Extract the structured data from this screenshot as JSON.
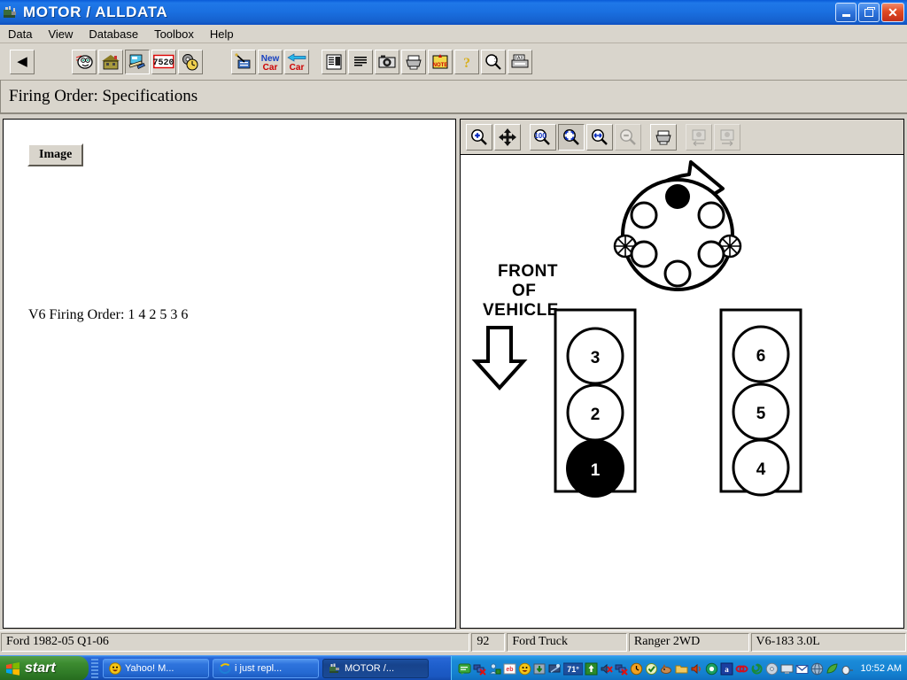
{
  "window": {
    "title": "MOTOR / ALLDATA",
    "icon": "engine-icon",
    "minimize_label": "Minimize",
    "maximize_label": "Restore",
    "close_label": "Close"
  },
  "menubar": {
    "items": [
      {
        "label": "Data",
        "name": "menu-data"
      },
      {
        "label": "View",
        "name": "menu-view"
      },
      {
        "label": "Database",
        "name": "menu-database"
      },
      {
        "label": "Toolbox",
        "name": "menu-toolbox"
      },
      {
        "label": "Help",
        "name": "menu-help"
      }
    ]
  },
  "toolbar": {
    "buttons": [
      {
        "name": "back-button",
        "icon": "left-arrow-icon",
        "glyph": "◀",
        "state": "raised",
        "color": "#000000"
      },
      {
        "name": "mascot-button",
        "icon": "face-icon",
        "glyph": "☺",
        "state": "raised",
        "color": "#1b1b1b"
      },
      {
        "name": "home-button",
        "icon": "house-icon",
        "glyph": "⌂",
        "state": "raised",
        "color": "#6b6320"
      },
      {
        "name": "repair-button",
        "icon": "tools-icon",
        "glyph": "⚒",
        "state": "sunken",
        "color": "#1c5aa8"
      },
      {
        "name": "estimator-button",
        "icon": "calculator-icon",
        "glyph": "7520",
        "state": "raised",
        "color": "#cc0000"
      },
      {
        "name": "labor-time-button",
        "icon": "gear-clock-icon",
        "glyph": "⚙",
        "state": "raised",
        "color": "#b08a20"
      },
      {
        "name": "worksheet-button",
        "icon": "clipboard-pen-icon",
        "glyph": "✎",
        "state": "raised",
        "color": "#1c5aa8"
      },
      {
        "name": "new-car-button",
        "icon": "new-car-icon",
        "glyph": "New Car",
        "state": "raised",
        "color": "#cc0000"
      },
      {
        "name": "prev-car-button",
        "icon": "back-car-icon",
        "glyph": "Car",
        "state": "raised",
        "color": "#cc0000"
      },
      {
        "name": "index-button",
        "icon": "list-index-icon",
        "glyph": "≡",
        "state": "raised",
        "color": "#111111"
      },
      {
        "name": "text-button",
        "icon": "paragraph-icon",
        "glyph": "☰",
        "state": "raised",
        "color": "#111111"
      },
      {
        "name": "image-button",
        "icon": "camera-icon",
        "glyph": "▣",
        "state": "raised",
        "color": "#111111"
      },
      {
        "name": "print-button",
        "icon": "printer-icon",
        "glyph": "⎙",
        "state": "raised",
        "color": "#333333"
      },
      {
        "name": "note-button",
        "icon": "note-pin-icon",
        "glyph": "NOTE",
        "state": "raised",
        "color": "#cc0000"
      },
      {
        "name": "help-button",
        "icon": "question-mark-icon",
        "glyph": "?",
        "state": "raised",
        "color": "#c8a000"
      },
      {
        "name": "find-button",
        "icon": "magnifier-az-icon",
        "glyph": "ὐD",
        "state": "raised",
        "color": "#111111"
      },
      {
        "name": "fax-button",
        "icon": "fax-icon",
        "glyph": "FAX",
        "state": "raised",
        "color": "#333333"
      }
    ]
  },
  "section": {
    "title": "Firing Order:  Specifications"
  },
  "left_panel": {
    "image_button_label": "Image",
    "body_text": "V6 Firing Order: 1 4 2 5 3 6"
  },
  "viewer_toolbar": {
    "buttons": [
      {
        "name": "zoom-in-button",
        "icon": "magnifier-plus-icon",
        "state": "raised"
      },
      {
        "name": "pan-button",
        "icon": "four-way-move-icon",
        "state": "raised"
      },
      {
        "name": "zoom-100-button",
        "icon": "magnifier-100-percent-icon",
        "state": "raised"
      },
      {
        "name": "fit-page-button",
        "icon": "magnifier-fit-page-icon",
        "state": "pressed"
      },
      {
        "name": "fit-width-button",
        "icon": "magnifier-fit-width-icon",
        "state": "raised"
      },
      {
        "name": "zoom-out-button",
        "icon": "magnifier-minus-icon",
        "state": "disabled"
      },
      {
        "name": "print-image-button",
        "icon": "printer-icon",
        "state": "raised"
      },
      {
        "name": "previous-image-button",
        "icon": "previous-image-icon",
        "state": "disabled"
      },
      {
        "name": "next-image-button",
        "icon": "next-image-icon",
        "state": "disabled"
      }
    ]
  },
  "diagram": {
    "front_of_vehicle_label_line1": "FRONT",
    "front_of_vehicle_label_line2": "OF",
    "front_of_vehicle_label_line3": "VEHICLE",
    "rotation": "clockwise",
    "distributor": {
      "name": "distributor-cap",
      "terminals": 6,
      "marked_terminal_position": "top",
      "marked_terminal_fill": "#000000",
      "side_markers": 2
    },
    "left_bank": {
      "name": "left-cylinder-bank",
      "cylinders": [
        {
          "number": "3",
          "filled": false
        },
        {
          "number": "2",
          "filled": false
        },
        {
          "number": "1",
          "filled": true
        }
      ]
    },
    "right_bank": {
      "name": "right-cylinder-bank",
      "cylinders": [
        {
          "number": "6",
          "filled": false
        },
        {
          "number": "5",
          "filled": false
        },
        {
          "number": "4",
          "filled": false
        }
      ]
    }
  },
  "statusbar": {
    "database": "Ford 1982-05 Q1-06",
    "year": "92",
    "make": "Ford Truck",
    "model": "Ranger 2WD",
    "engine": "V6-183 3.0L"
  },
  "taskbar": {
    "start_label": "start",
    "tasks": [
      {
        "label": "Yahoo! M...",
        "icon": "yahoo-messenger-icon",
        "active": false
      },
      {
        "label": "i just repl...",
        "icon": "internet-explorer-icon",
        "active": false
      },
      {
        "label": "MOTOR /...",
        "icon": "engine-icon",
        "active": true
      }
    ],
    "tray": {
      "temperature": "71",
      "clock": "10:52 AM",
      "icons": [
        "messenger-icon",
        "network-disconnected-icon",
        "user-accounts-icon",
        "ebay-icon",
        "smiley-icon",
        "download-icon",
        "display-icon",
        "weather-icon",
        "update-icon",
        "volume-muted-icon",
        "network-error-icon",
        "clock-icon",
        "shield-check-icon",
        "dog-icon",
        "folder-icon",
        "speaker-icon",
        "antivirus-icon",
        "at-symbol-icon",
        "link-icon",
        "spiral-icon",
        "disc-icon",
        "monitor-icon",
        "mail-icon",
        "globe-icon",
        "leaf-icon",
        "mouse-icon"
      ]
    }
  }
}
